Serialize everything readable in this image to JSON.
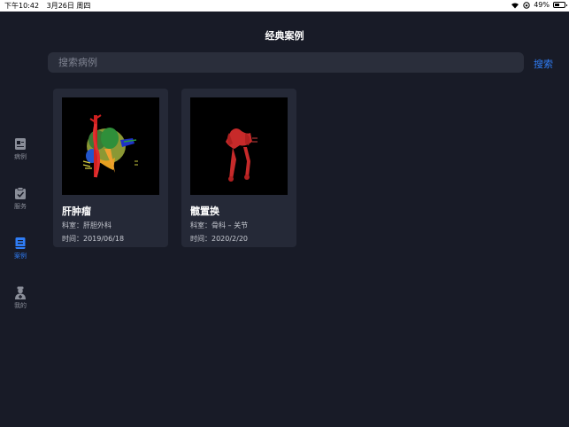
{
  "status_bar": {
    "time": "下午10:42",
    "date": "3月26日 周四",
    "battery": "49%"
  },
  "page": {
    "title": "经典案例"
  },
  "search": {
    "placeholder": "搜索病例",
    "button_label": "搜索"
  },
  "sidebar": {
    "items": [
      {
        "label": "病例",
        "icon": "medical-record-icon",
        "active": false
      },
      {
        "label": "服务",
        "icon": "clipboard-check-icon",
        "active": false
      },
      {
        "label": "案例",
        "icon": "book-icon",
        "active": true
      },
      {
        "label": "我的",
        "icon": "doctor-profile-icon",
        "active": false
      }
    ]
  },
  "cases": [
    {
      "name": "肝肿瘤",
      "dept": "科室：肝胆外科",
      "time": "时间：2019/06/18"
    },
    {
      "name": "髋置换",
      "dept": "科室：骨科 – 关节",
      "time": "时间：2020/2/20"
    }
  ],
  "colors": {
    "background": "#181b27",
    "card": "#252937",
    "accent": "#2f7df6",
    "nav_inactive": "#8a8e99"
  }
}
